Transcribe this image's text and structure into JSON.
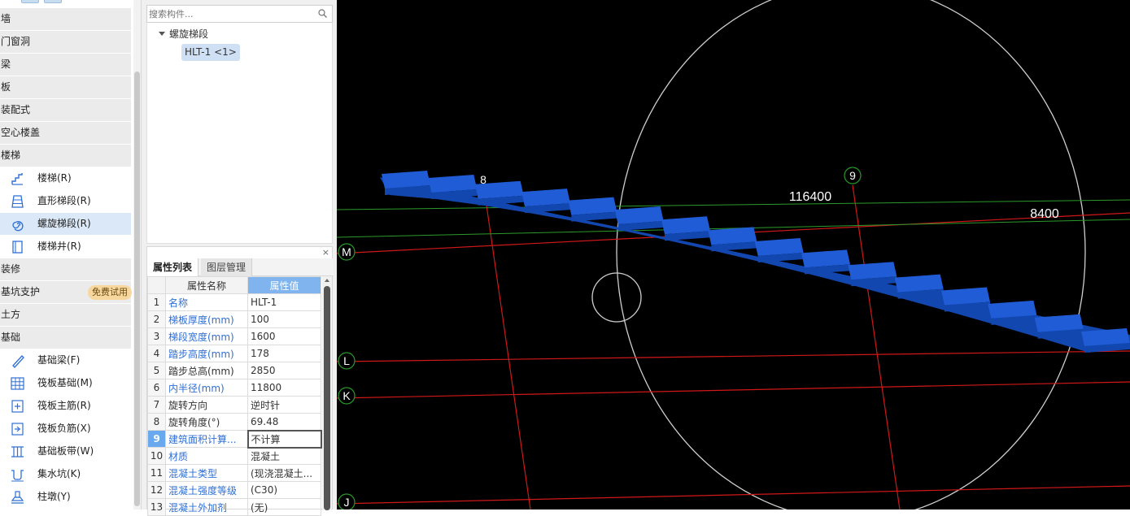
{
  "left_panel": {
    "categories": [
      "墙",
      "门窗洞",
      "梁",
      "板",
      "装配式",
      "空心楼盖",
      "楼梯",
      "装修",
      "基坑支护",
      "土方",
      "基础"
    ],
    "trial_badge": "免费试用",
    "stair_items": [
      "楼梯(R)",
      "直形梯段(R)",
      "螺旋梯段(R)",
      "楼梯井(R)"
    ],
    "foundation_items": [
      "基础梁(F)",
      "筏板基础(M)",
      "筏板主筋(R)",
      "筏板负筋(X)",
      "基础板带(W)",
      "集水坑(K)",
      "柱墩(Y)"
    ]
  },
  "component_tree": {
    "search_placeholder": "搜索构件...",
    "node": "螺旋梯段",
    "leaf": "HLT-1 <1>"
  },
  "properties": {
    "close": "×",
    "tabs": [
      "属性列表",
      "图层管理"
    ],
    "header_name": "属性名称",
    "header_value": "属性值",
    "rows": [
      {
        "n": "1",
        "name": "名称",
        "value": "HLT-1"
      },
      {
        "n": "2",
        "name": "梯板厚度(mm)",
        "value": "100"
      },
      {
        "n": "3",
        "name": "梯段宽度(mm)",
        "value": "1600"
      },
      {
        "n": "4",
        "name": "踏步高度(mm)",
        "value": "178"
      },
      {
        "n": "5",
        "name": "踏步总高(mm)",
        "value": "2850"
      },
      {
        "n": "6",
        "name": "内半径(mm)",
        "value": "11800"
      },
      {
        "n": "7",
        "name": "旋转方向",
        "value": "逆时针"
      },
      {
        "n": "8",
        "name": "旋转角度(°)",
        "value": "69.48"
      },
      {
        "n": "9",
        "name": "建筑面积计算...",
        "value": "不计算"
      },
      {
        "n": "10",
        "name": "材质",
        "value": "混凝土"
      },
      {
        "n": "11",
        "name": "混凝土类型",
        "value": "(现浇混凝土..."
      },
      {
        "n": "12",
        "name": "混凝土强度等级",
        "value": "(C30)"
      },
      {
        "n": "13",
        "name": "混凝土外加剂",
        "value": "(无)"
      }
    ]
  },
  "viewport": {
    "axis_labels": [
      "M",
      "L",
      "K",
      "J",
      "9",
      "8"
    ],
    "dimensions": [
      "116400",
      "8400"
    ],
    "colors": {
      "stair_top": "#1f5cd6",
      "stair_front": "#1247b0",
      "axis": "#d01818",
      "dim": "#2a9a2a",
      "circle": "#d0d0d0"
    }
  }
}
